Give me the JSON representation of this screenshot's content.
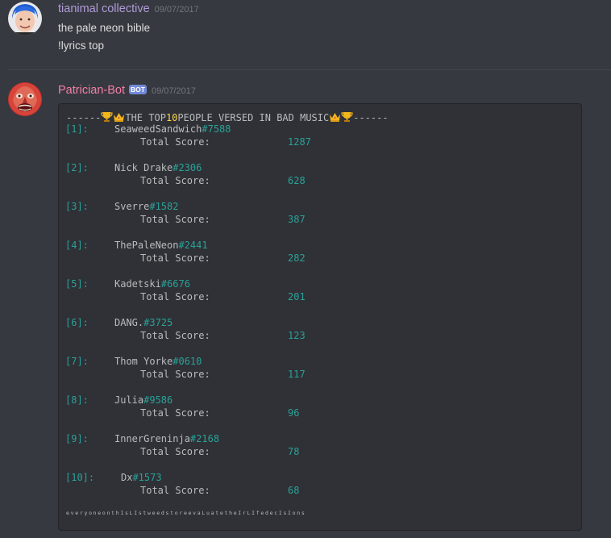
{
  "colors": {
    "background": "#36393f",
    "codeblock_bg": "#2f3136",
    "user1_name": "#b19cd9",
    "bot_name": "#f47fa8",
    "bot_badge": "#7289da",
    "teal": "#2aa198",
    "gold": "#ffd54a"
  },
  "messages": [
    {
      "username": "tianimal collective",
      "timestamp": "09/07/2017",
      "lines": [
        "the pale neon bible",
        "!lyrics top"
      ]
    },
    {
      "username": "Patrician-Bot",
      "badge": "BOT",
      "timestamp": "09/07/2017",
      "code": {
        "header_prefix": "------",
        "header_text1": "THE TOP ",
        "header_number": "10",
        "header_text2": " PEOPLE VERSED IN BAD MUSIC",
        "header_suffix": "------",
        "header_icons": [
          "trophy-icon",
          "crown-icon",
          "crown-icon",
          "trophy-icon"
        ],
        "score_label": "Total Score:",
        "entries": [
          {
            "rank": "[1]:",
            "name": "SeaweedSandwich",
            "tag": "#7588",
            "score": "1287"
          },
          {
            "rank": "[2]:",
            "name": "Nick Drake",
            "tag": "#2306",
            "score": "628"
          },
          {
            "rank": "[3]:",
            "name": "Sverre",
            "tag": "#1582",
            "score": "387"
          },
          {
            "rank": "[4]:",
            "name": "ThePaleNeon",
            "tag": "#2441",
            "score": "282"
          },
          {
            "rank": "[5]:",
            "name": "Kadetski",
            "tag": "#6676",
            "score": "201"
          },
          {
            "rank": "[6]:",
            "name": "DANG.",
            "tag": "#3725",
            "score": "123"
          },
          {
            "rank": "[7]:",
            "name": "Thom Yorke",
            "tag": "#0610",
            "score": "117"
          },
          {
            "rank": "[8]:",
            "name": "Julia",
            "tag": "#9586",
            "score": "96"
          },
          {
            "rank": "[9]:",
            "name": "InnerGreninja",
            "tag": "#2168",
            "score": "78"
          },
          {
            "rank": "[10]:",
            "name": "Dx",
            "tag": "#1573",
            "score": "68"
          }
        ],
        "footer": "everyoneonthIsLIstweedstoreevaLuatetheIrLIfedecIsIons"
      }
    }
  ]
}
